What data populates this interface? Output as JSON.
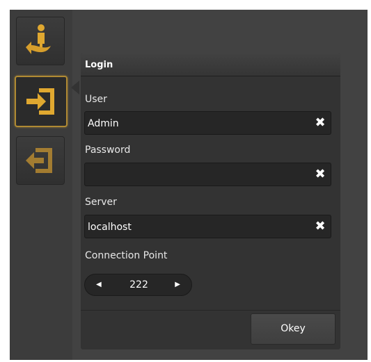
{
  "sidebar": {
    "buttons": [
      {
        "name": "user-icon",
        "state": "normal"
      },
      {
        "name": "login-icon",
        "state": "active"
      },
      {
        "name": "logout-icon",
        "state": "normal"
      }
    ],
    "accent_color": "#e0a830"
  },
  "login_panel": {
    "title": "Login",
    "user": {
      "label": "User",
      "value": "Admin"
    },
    "password": {
      "label": "Password",
      "value": ""
    },
    "server": {
      "label": "Server",
      "value": "localhost"
    },
    "connection_point": {
      "label": "Connection Point",
      "value": "222"
    },
    "okey_label": "Okey",
    "clear_glyph": "✖"
  }
}
